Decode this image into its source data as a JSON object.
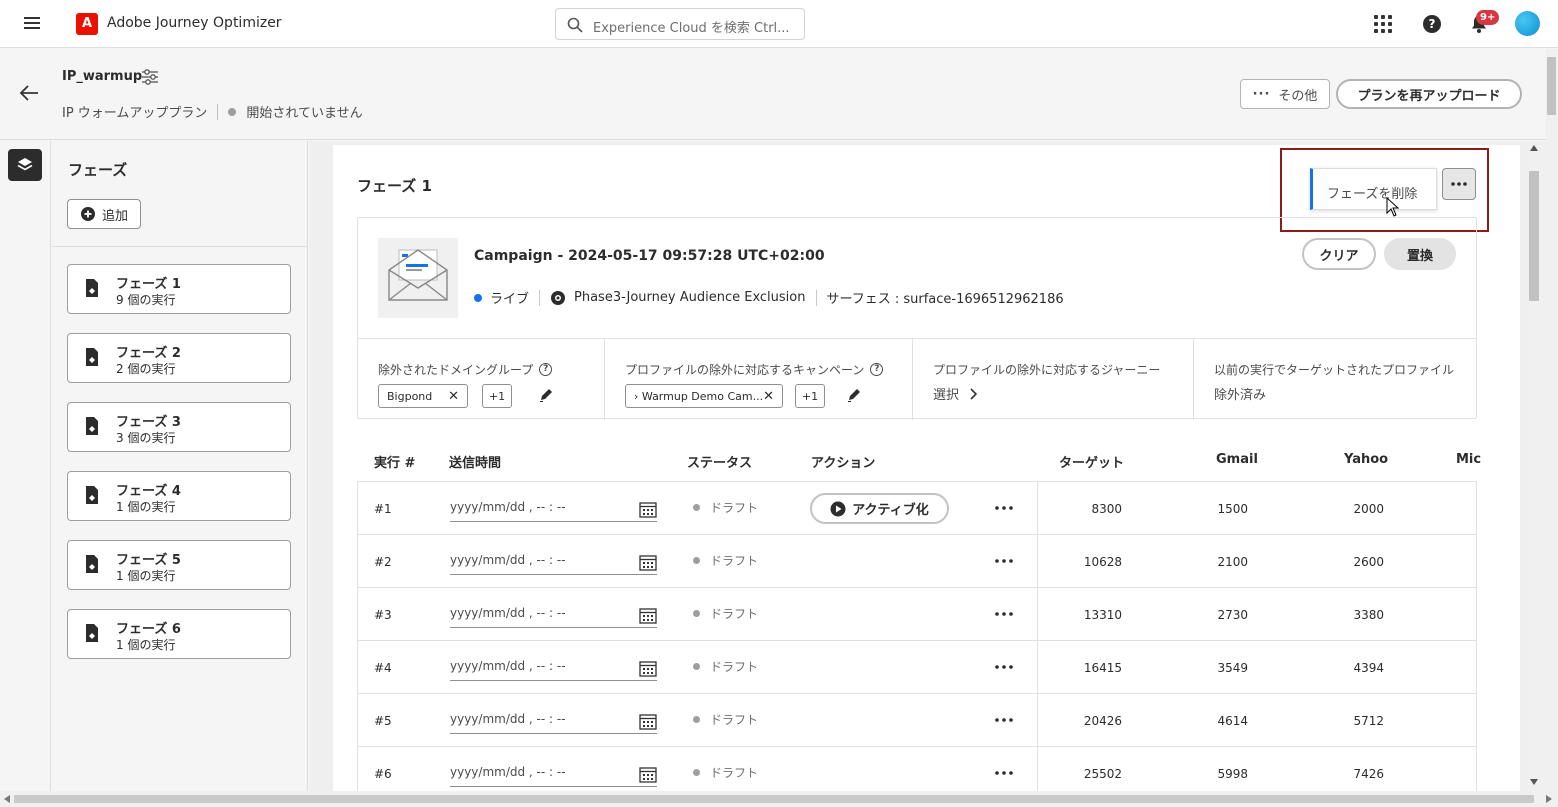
{
  "app": {
    "title": "Adobe Journey Optimizer",
    "logo_letter": "A"
  },
  "search": {
    "placeholder": "Experience Cloud を検索 Ctrl..."
  },
  "notifications": {
    "badge": "9+"
  },
  "plan": {
    "name": "IP_warmup",
    "subtitle": "IP ウォームアッププラン",
    "status": "開始されていません",
    "more_label": "その他",
    "reupload_label": "プランを再アップロード"
  },
  "phases_panel": {
    "title": "フェーズ",
    "add_label": "追加",
    "items": [
      {
        "name": "フェーズ 1",
        "count": "9 個の実行"
      },
      {
        "name": "フェーズ 2",
        "count": "2 個の実行"
      },
      {
        "name": "フェーズ 3",
        "count": "3 個の実行"
      },
      {
        "name": "フェーズ 4",
        "count": "1 個の実行"
      },
      {
        "name": "フェーズ 5",
        "count": "1 個の実行"
      },
      {
        "name": "フェーズ 6",
        "count": "1 個の実行"
      }
    ]
  },
  "main": {
    "phase_title": "フェーズ 1",
    "delete_phase_label": "フェーズを削除",
    "campaign": {
      "title": "Campaign - 2024-05-17 09:57:28 UTC+02:00",
      "status": "ライブ",
      "journey": "Phase3-Journey Audience Exclusion",
      "surface": "サーフェス : surface-1696512962186",
      "clear_label": "クリア",
      "replace_label": "置換"
    },
    "exclusions": {
      "domain_groups_label": "除外されたドメイングループ",
      "domain_tag": "Bigpond",
      "domain_plus": "+1",
      "campaign_label": "プロファイルの除外に対応するキャンペーン",
      "campaign_tag": "› Warmup Demo Cam...",
      "campaign_plus": "+1",
      "journey_label": "プロファイルの除外に対応するジャーニー",
      "journey_value": "選択",
      "previous_label": "以前の実行でターゲットされたプロファイル",
      "previous_value": "除外済み"
    },
    "table": {
      "headers": {
        "run": "実行 #",
        "send_time": "送信時間",
        "status": "ステータス",
        "action": "アクション",
        "target": "ターゲット",
        "gmail": "Gmail",
        "yahoo": "Yahoo",
        "microsoft": "Mic"
      },
      "activate_label": "アクティブ化",
      "date_placeholder": "yyyy/mm/dd , -- : --",
      "status_draft": "ドラフト",
      "rows": [
        {
          "num": "#1",
          "target": "8300",
          "gmail": "1500",
          "yahoo": "2000"
        },
        {
          "num": "#2",
          "target": "10628",
          "gmail": "2100",
          "yahoo": "2600"
        },
        {
          "num": "#3",
          "target": "13310",
          "gmail": "2730",
          "yahoo": "3380"
        },
        {
          "num": "#4",
          "target": "16415",
          "gmail": "3549",
          "yahoo": "4394"
        },
        {
          "num": "#5",
          "target": "20426",
          "gmail": "4614",
          "yahoo": "5712"
        },
        {
          "num": "#6",
          "target": "25502",
          "gmail": "5998",
          "yahoo": "7426"
        }
      ]
    }
  }
}
